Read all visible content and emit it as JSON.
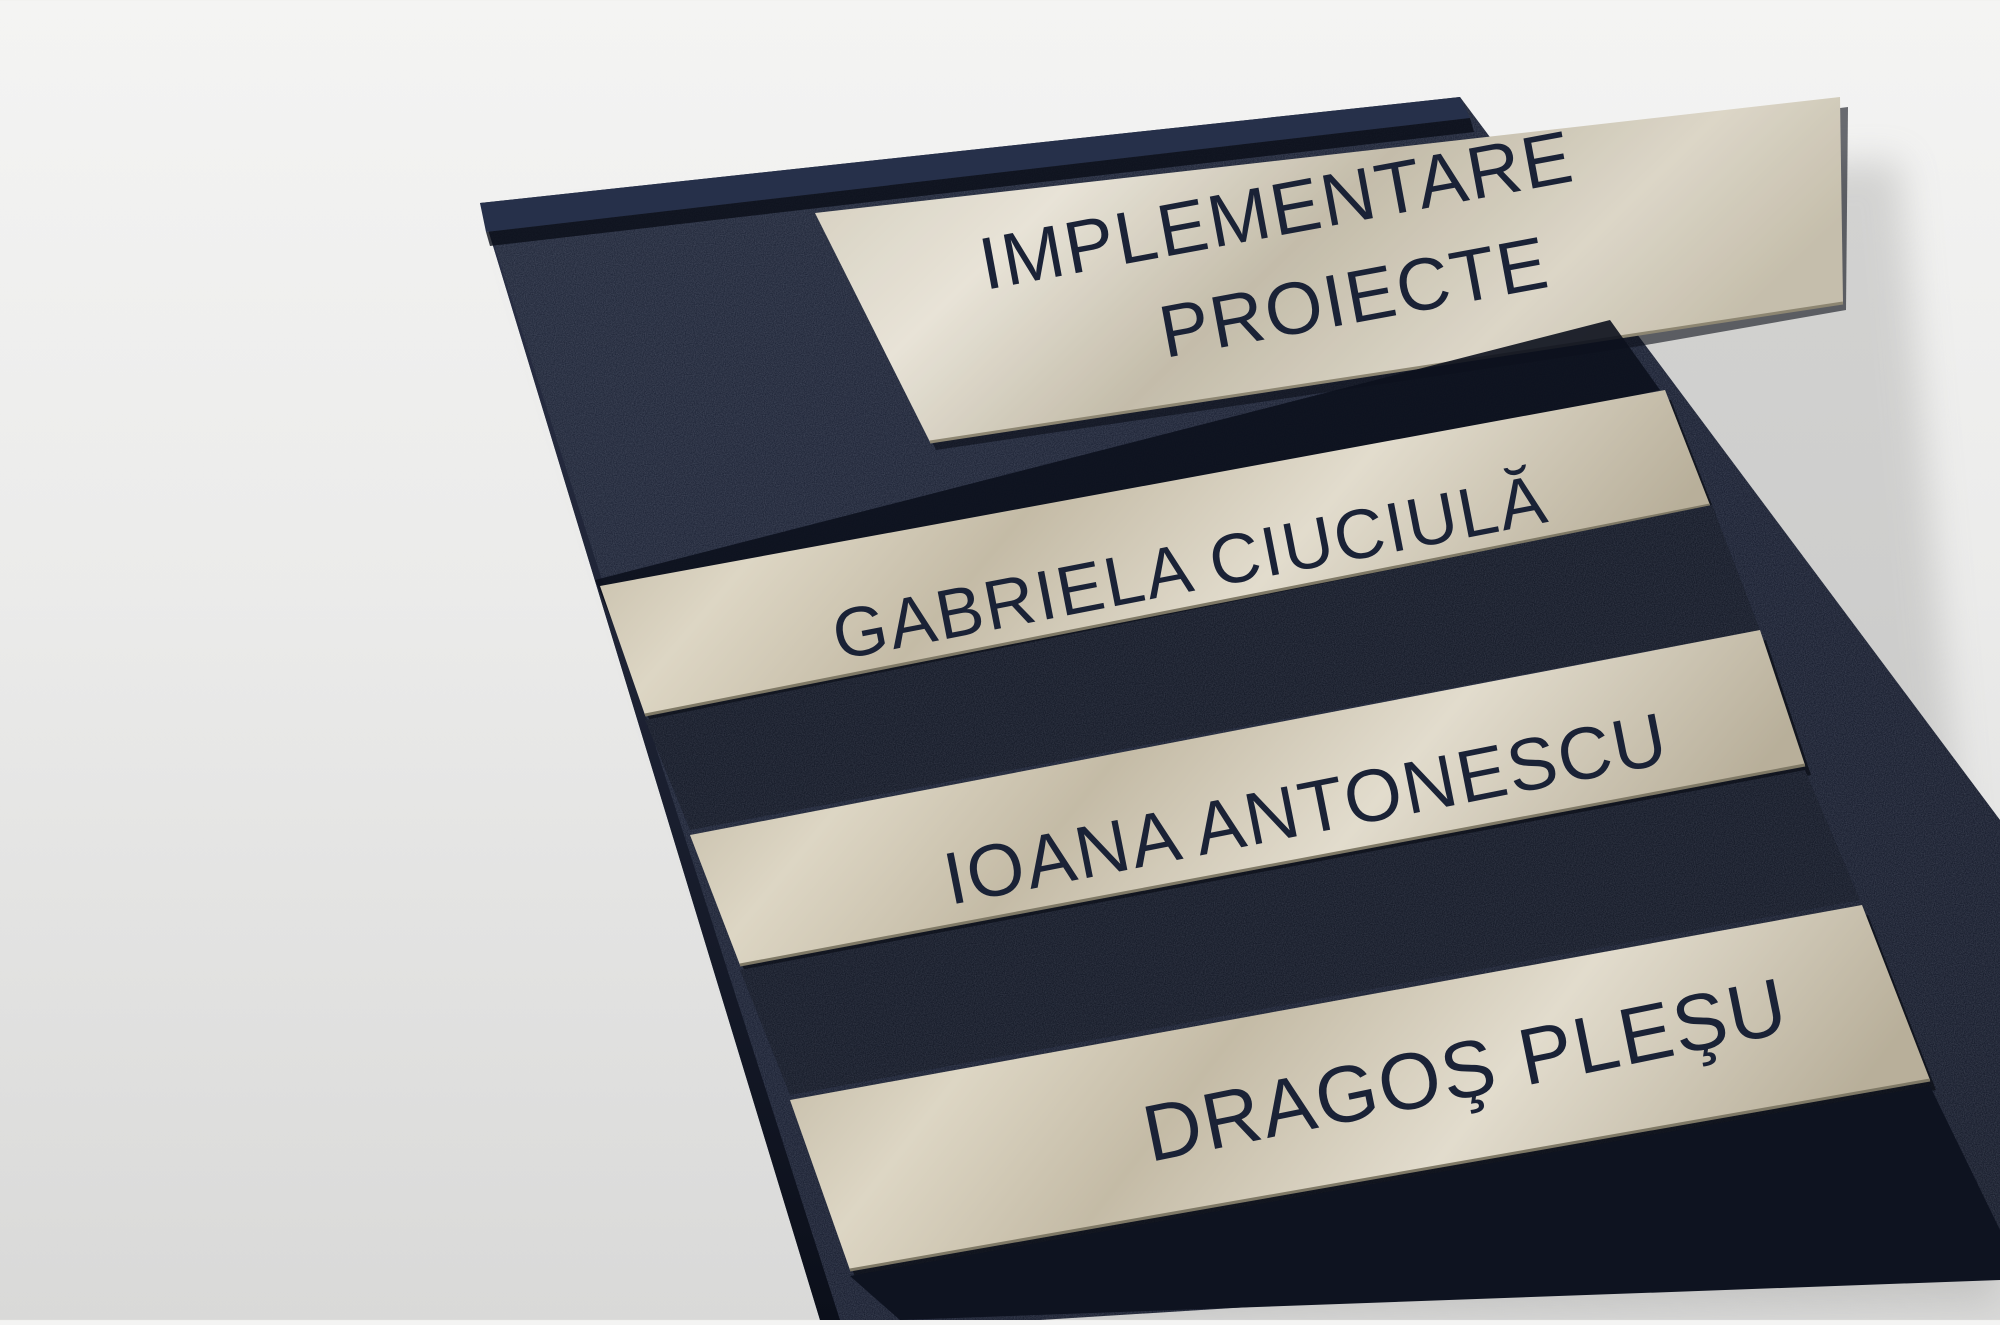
{
  "colors": {
    "background": "#eeeeed",
    "board": "#151b2b",
    "plate_metal": "#c6bda9",
    "engraving": "#1a2236"
  },
  "sign": {
    "department_lines": [
      "IMPLEMENTARE",
      "PROIECTE"
    ],
    "names": [
      "GABRIELA CIUCIULĂ",
      "IOANA ANTONESCU",
      "DRAGOŞ PLEŞU"
    ]
  }
}
